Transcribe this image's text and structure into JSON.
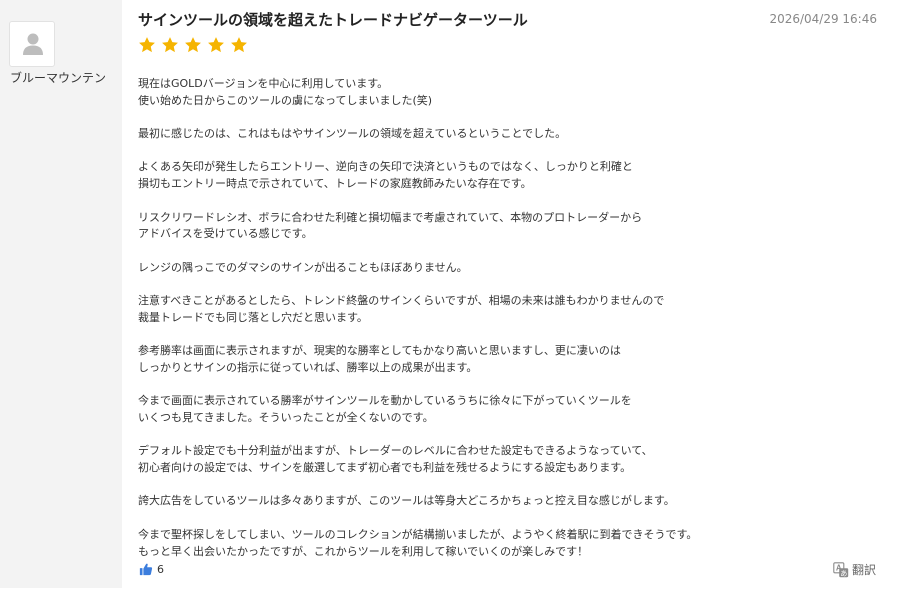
{
  "reviewer": {
    "name": "ブルーマウンテン",
    "avatar_icon": "user-silhouette-icon"
  },
  "review": {
    "title": "サインツールの領域を超えたトレードナビゲーターツール",
    "date": "2026/04/29 16:46",
    "rating": 5,
    "rating_max": 5,
    "star_color": "#f5b400",
    "paragraphs": [
      [
        "現在はGOLDバージョンを中心に利用しています。",
        "使い始めた日からこのツールの虜になってしまいました(笑)"
      ],
      [
        "最初に感じたのは、これはもはやサインツールの領域を超えているということでした。"
      ],
      [
        "よくある矢印が発生したらエントリー、逆向きの矢印で決済というものではなく、しっかりと利確と",
        "損切もエントリー時点で示されていて、トレードの家庭教師みたいな存在です。"
      ],
      [
        "リスクリワードレシオ、ボラに合わせた利確と損切幅まで考慮されていて、本物のプロトレーダーから",
        "アドバイスを受けている感じです。"
      ],
      [
        "レンジの隅っこでのダマシのサインが出ることもほぼありません。"
      ],
      [
        "注意すべきことがあるとしたら、トレンド終盤のサインくらいですが、相場の未来は誰もわかりませんので",
        "裁量トレードでも同じ落とし穴だと思います。"
      ],
      [
        "参考勝率は画面に表示されますが、現実的な勝率としてもかなり高いと思いますし、更に凄いのは",
        "しっかりとサインの指示に従っていれば、勝率以上の成果が出ます。"
      ],
      [
        "今まで画面に表示されている勝率がサインツールを動かしているうちに徐々に下がっていくツールを",
        "いくつも見てきました。そういったことが全くないのです。"
      ],
      [
        "デフォルト設定でも十分利益が出ますが、トレーダーのレベルに合わせた設定もできるようなっていて、",
        "初心者向けの設定では、サインを厳選してまず初心者でも利益を残せるようにする設定もあります。"
      ],
      [
        "誇大広告をしているツールは多々ありますが、このツールは等身大どころかちょっと控え目な感じがします。"
      ],
      [
        "今まで聖杯探しをしてしまい、ツールのコレクションが結構揃いましたが、ようやく終着駅に到着できそうです。",
        "もっと早く出会いたかったですが、これからツールを利用して稼いでいくのが楽しみです！"
      ]
    ]
  },
  "actions": {
    "like_icon": "thumbs-up-icon",
    "like_color": "#3b7ddd",
    "like_count": "6",
    "translate_icon": "translate-icon",
    "translate_label": "翻訳"
  }
}
